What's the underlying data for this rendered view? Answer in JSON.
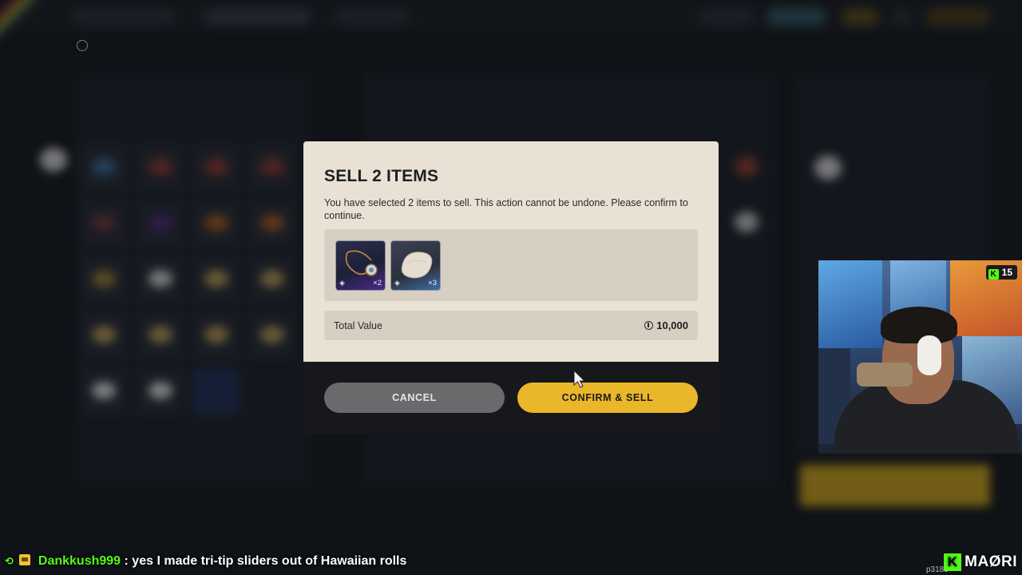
{
  "modal": {
    "title": "SELL 2 ITEMS",
    "description": "You have selected 2 items to sell. This action cannot be undone. Please confirm to continue.",
    "items": [
      {
        "name": "necklace-item",
        "quantity": "×2"
      },
      {
        "name": "pillow-item",
        "quantity": "×3"
      }
    ],
    "total_label": "Total Value",
    "total_value": "10,000",
    "cancel_label": "CANCEL",
    "confirm_label": "CONFIRM & SELL"
  },
  "webcam": {
    "viewer_count": "15"
  },
  "chat": {
    "username": "Dankkush999",
    "message": ": yes I made tri-tip sliders out of Hawaiian rolls"
  },
  "branding": {
    "channel": "MAØRI",
    "build": "p3183"
  },
  "colors": {
    "confirm_button": "#eab62a",
    "cancel_button": "#6a6a6c",
    "modal_panel": "#e9e2d4",
    "kick_green": "#53fc18"
  }
}
